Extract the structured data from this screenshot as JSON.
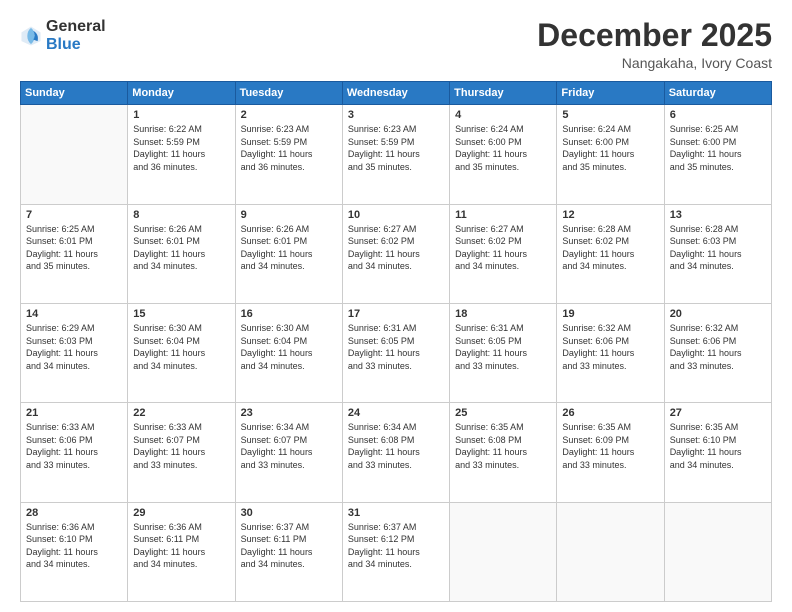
{
  "logo": {
    "general": "General",
    "blue": "Blue"
  },
  "header": {
    "month": "December 2025",
    "location": "Nangakaha, Ivory Coast"
  },
  "weekdays": [
    "Sunday",
    "Monday",
    "Tuesday",
    "Wednesday",
    "Thursday",
    "Friday",
    "Saturday"
  ],
  "weeks": [
    [
      {
        "day": "",
        "text": ""
      },
      {
        "day": "1",
        "text": "Sunrise: 6:22 AM\nSunset: 5:59 PM\nDaylight: 11 hours\nand 36 minutes."
      },
      {
        "day": "2",
        "text": "Sunrise: 6:23 AM\nSunset: 5:59 PM\nDaylight: 11 hours\nand 36 minutes."
      },
      {
        "day": "3",
        "text": "Sunrise: 6:23 AM\nSunset: 5:59 PM\nDaylight: 11 hours\nand 35 minutes."
      },
      {
        "day": "4",
        "text": "Sunrise: 6:24 AM\nSunset: 6:00 PM\nDaylight: 11 hours\nand 35 minutes."
      },
      {
        "day": "5",
        "text": "Sunrise: 6:24 AM\nSunset: 6:00 PM\nDaylight: 11 hours\nand 35 minutes."
      },
      {
        "day": "6",
        "text": "Sunrise: 6:25 AM\nSunset: 6:00 PM\nDaylight: 11 hours\nand 35 minutes."
      }
    ],
    [
      {
        "day": "7",
        "text": "Sunrise: 6:25 AM\nSunset: 6:01 PM\nDaylight: 11 hours\nand 35 minutes."
      },
      {
        "day": "8",
        "text": "Sunrise: 6:26 AM\nSunset: 6:01 PM\nDaylight: 11 hours\nand 34 minutes."
      },
      {
        "day": "9",
        "text": "Sunrise: 6:26 AM\nSunset: 6:01 PM\nDaylight: 11 hours\nand 34 minutes."
      },
      {
        "day": "10",
        "text": "Sunrise: 6:27 AM\nSunset: 6:02 PM\nDaylight: 11 hours\nand 34 minutes."
      },
      {
        "day": "11",
        "text": "Sunrise: 6:27 AM\nSunset: 6:02 PM\nDaylight: 11 hours\nand 34 minutes."
      },
      {
        "day": "12",
        "text": "Sunrise: 6:28 AM\nSunset: 6:02 PM\nDaylight: 11 hours\nand 34 minutes."
      },
      {
        "day": "13",
        "text": "Sunrise: 6:28 AM\nSunset: 6:03 PM\nDaylight: 11 hours\nand 34 minutes."
      }
    ],
    [
      {
        "day": "14",
        "text": "Sunrise: 6:29 AM\nSunset: 6:03 PM\nDaylight: 11 hours\nand 34 minutes."
      },
      {
        "day": "15",
        "text": "Sunrise: 6:30 AM\nSunset: 6:04 PM\nDaylight: 11 hours\nand 34 minutes."
      },
      {
        "day": "16",
        "text": "Sunrise: 6:30 AM\nSunset: 6:04 PM\nDaylight: 11 hours\nand 34 minutes."
      },
      {
        "day": "17",
        "text": "Sunrise: 6:31 AM\nSunset: 6:05 PM\nDaylight: 11 hours\nand 33 minutes."
      },
      {
        "day": "18",
        "text": "Sunrise: 6:31 AM\nSunset: 6:05 PM\nDaylight: 11 hours\nand 33 minutes."
      },
      {
        "day": "19",
        "text": "Sunrise: 6:32 AM\nSunset: 6:06 PM\nDaylight: 11 hours\nand 33 minutes."
      },
      {
        "day": "20",
        "text": "Sunrise: 6:32 AM\nSunset: 6:06 PM\nDaylight: 11 hours\nand 33 minutes."
      }
    ],
    [
      {
        "day": "21",
        "text": "Sunrise: 6:33 AM\nSunset: 6:06 PM\nDaylight: 11 hours\nand 33 minutes."
      },
      {
        "day": "22",
        "text": "Sunrise: 6:33 AM\nSunset: 6:07 PM\nDaylight: 11 hours\nand 33 minutes."
      },
      {
        "day": "23",
        "text": "Sunrise: 6:34 AM\nSunset: 6:07 PM\nDaylight: 11 hours\nand 33 minutes."
      },
      {
        "day": "24",
        "text": "Sunrise: 6:34 AM\nSunset: 6:08 PM\nDaylight: 11 hours\nand 33 minutes."
      },
      {
        "day": "25",
        "text": "Sunrise: 6:35 AM\nSunset: 6:08 PM\nDaylight: 11 hours\nand 33 minutes."
      },
      {
        "day": "26",
        "text": "Sunrise: 6:35 AM\nSunset: 6:09 PM\nDaylight: 11 hours\nand 33 minutes."
      },
      {
        "day": "27",
        "text": "Sunrise: 6:35 AM\nSunset: 6:10 PM\nDaylight: 11 hours\nand 34 minutes."
      }
    ],
    [
      {
        "day": "28",
        "text": "Sunrise: 6:36 AM\nSunset: 6:10 PM\nDaylight: 11 hours\nand 34 minutes."
      },
      {
        "day": "29",
        "text": "Sunrise: 6:36 AM\nSunset: 6:11 PM\nDaylight: 11 hours\nand 34 minutes."
      },
      {
        "day": "30",
        "text": "Sunrise: 6:37 AM\nSunset: 6:11 PM\nDaylight: 11 hours\nand 34 minutes."
      },
      {
        "day": "31",
        "text": "Sunrise: 6:37 AM\nSunset: 6:12 PM\nDaylight: 11 hours\nand 34 minutes."
      },
      {
        "day": "",
        "text": ""
      },
      {
        "day": "",
        "text": ""
      },
      {
        "day": "",
        "text": ""
      }
    ]
  ]
}
